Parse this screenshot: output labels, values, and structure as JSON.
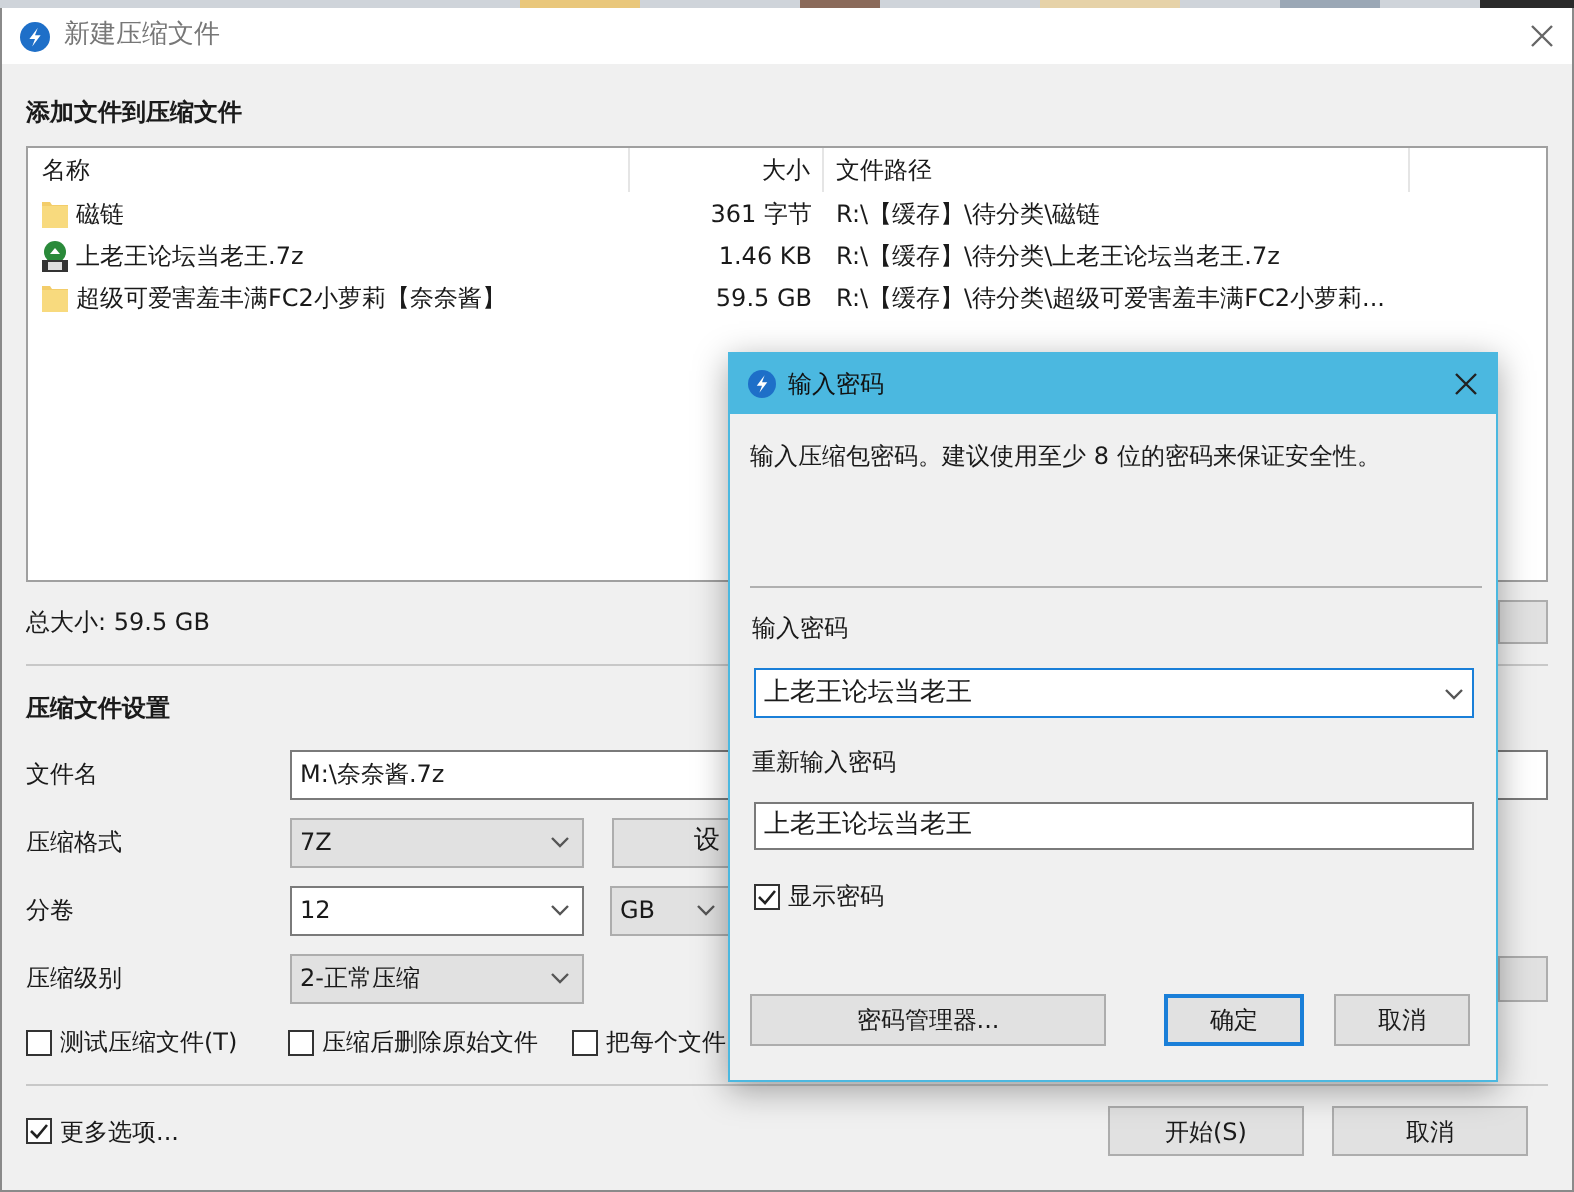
{
  "window": {
    "title": "新建压缩文件"
  },
  "files": {
    "heading": "添加文件到压缩文件",
    "columns": [
      "名称",
      "大小",
      "文件路径"
    ],
    "rows": [
      {
        "kind": "folder",
        "name": "磁链",
        "size": "361 字节",
        "path": "R:\\【缓存】\\待分类\\磁链"
      },
      {
        "kind": "archive",
        "name": "上老王论坛当老王.7z",
        "size": "1.46 KB",
        "path": "R:\\【缓存】\\待分类\\上老王论坛当老王.7z"
      },
      {
        "kind": "folder",
        "name": "超级可爱害羞丰满FC2小萝莉【奈奈酱】",
        "size": "59.5 GB",
        "path": "R:\\【缓存】\\待分类\\超级可爱害羞丰满FC2小萝莉..."
      }
    ],
    "total": "总大小: 59.5 GB"
  },
  "settings": {
    "heading": "压缩文件设置",
    "filename": {
      "label": "文件名",
      "value": "M:\\奈奈酱.7z"
    },
    "format": {
      "label": "压缩格式",
      "value": "7Z",
      "button": "设"
    },
    "split": {
      "label": "分卷",
      "value": "12",
      "unit": "GB"
    },
    "level": {
      "label": "压缩级别",
      "value": "2-正常压缩"
    },
    "options": [
      {
        "label": "测试压缩文件(T)",
        "checked": false
      },
      {
        "label": "压缩后删除原始文件",
        "checked": false
      },
      {
        "label": "把每个文件",
        "checked": false
      }
    ]
  },
  "more_options": {
    "label": "更多选项...",
    "checked": true
  },
  "buttons": [
    "开始(S)",
    "取消"
  ],
  "password_dialog": {
    "title": "输入密码",
    "message": "输入压缩包密码。建议使用至少 8 位的密码来保证安全性。",
    "password_label": "输入密码",
    "password": "上老王论坛当老王",
    "confirm_label": "重新输入密码",
    "confirm": "上老王论坛当老王",
    "show_password": {
      "label": "显示密码",
      "checked": true
    },
    "buttons": [
      {
        "label": "密码管理器...",
        "default": false
      },
      {
        "label": "确定",
        "default": true
      },
      {
        "label": "取消",
        "default": false
      }
    ]
  }
}
